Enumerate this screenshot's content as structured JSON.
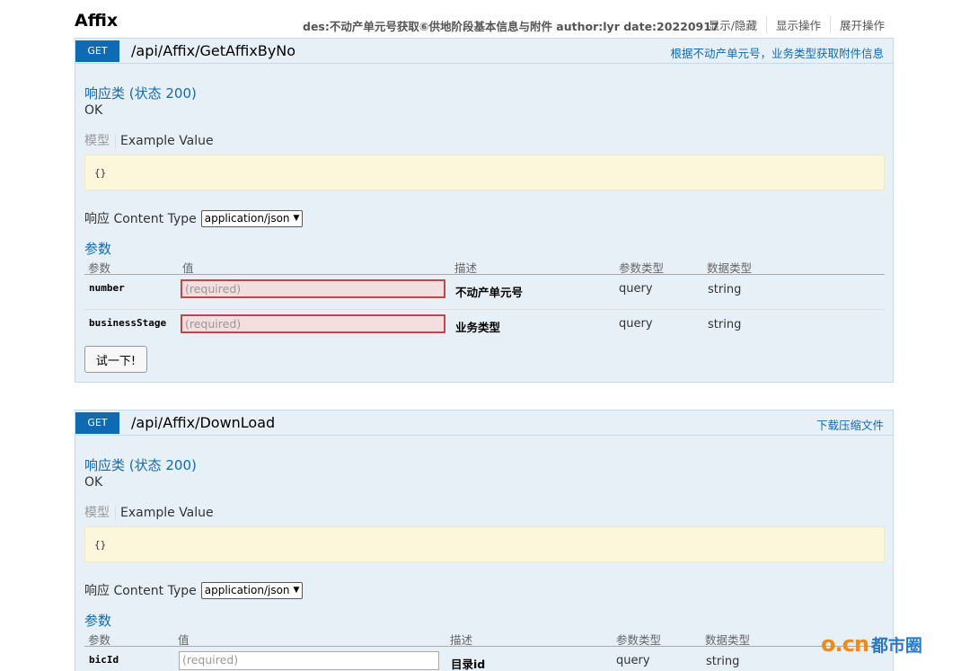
{
  "heading": {
    "title": "Affix",
    "description": "des:不动产单元号获取⑥供地阶段基本信息与附件 author:lyr date:20220917",
    "ops": [
      "显示/隐藏",
      "显示操作",
      "展开操作"
    ]
  },
  "operations": [
    {
      "method": "GET",
      "path": "/api/Affix/GetAffixByNo",
      "summary": "根据不动产单元号，业务类型获取附件信息",
      "response_title": "响应类 (状态 200)",
      "response_status": "OK",
      "model_tab": "模型",
      "example_tab": "Example Value",
      "example_value": "{}",
      "content_type_label": "响应 Content Type",
      "content_type_value": "application/json",
      "params_title": "参数",
      "param_headers": [
        "参数",
        "值",
        "描述",
        "参数类型",
        "数据类型"
      ],
      "params": [
        {
          "name": "number",
          "placeholder": "(required)",
          "description": "不动产单元号",
          "param_type": "query",
          "data_type": "string"
        },
        {
          "name": "businessStage",
          "placeholder": "(required)",
          "description": "业务类型",
          "param_type": "query",
          "data_type": "string"
        }
      ],
      "try_button": "试一下!"
    },
    {
      "method": "GET",
      "path": "/api/Affix/DownLoad",
      "summary": "下载压缩文件",
      "response_title": "响应类 (状态 200)",
      "response_status": "OK",
      "model_tab": "模型",
      "example_tab": "Example Value",
      "example_value": "{}",
      "content_type_label": "响应 Content Type",
      "content_type_value": "application/json",
      "params_title": "参数",
      "param_headers": [
        "参数",
        "值",
        "描述",
        "参数类型",
        "数据类型"
      ],
      "params": [
        {
          "name": "bicId",
          "placeholder": "(required)",
          "description": "目录id",
          "param_type": "query",
          "data_type": "string"
        }
      ]
    }
  ],
  "watermark": {
    "logo": "o.cn",
    "brand": "都市圈"
  },
  "colors": {
    "accent": "#0f6ab4",
    "panel_bg": "#e7f0f7",
    "signature_bg": "#fcf6db",
    "error_bg": "#f2dede",
    "error_border": "#b94a48"
  }
}
